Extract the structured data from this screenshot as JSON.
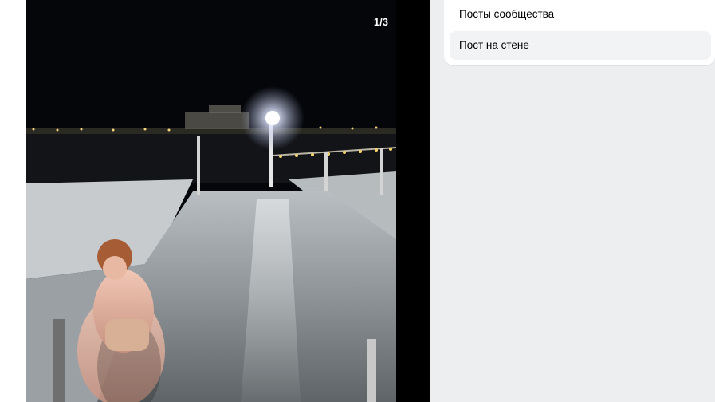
{
  "viewer": {
    "counter": "1/3"
  },
  "menu": {
    "items": [
      {
        "label": "Посты сообщества",
        "active": false
      },
      {
        "label": "Пост на стене",
        "active": true
      }
    ]
  },
  "colors": {
    "page_bg": "#edeef0",
    "panel_bg": "#ffffff",
    "active_item_bg": "#f2f3f5"
  }
}
